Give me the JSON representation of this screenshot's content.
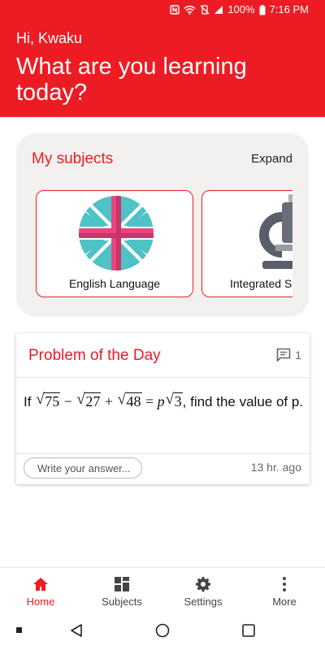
{
  "status_bar": {
    "battery": "100%",
    "time": "7:16 PM"
  },
  "header": {
    "greeting": "Hi, Kwaku",
    "headline": "What are you learning today?"
  },
  "subjects": {
    "title": "My subjects",
    "expand_label": "Expand",
    "items": [
      {
        "label": "English Language",
        "icon": "union-flag-icon"
      },
      {
        "label": "Integrated Science",
        "icon": "microscope-icon"
      }
    ]
  },
  "problem": {
    "title": "Problem of the Day",
    "comment_count": "1",
    "text_prefix": "If",
    "math": {
      "rad1": "75",
      "op1": "−",
      "rad2": "27",
      "op2": "+",
      "rad3": "48",
      "eq": "=",
      "var": "p",
      "rad4": "3"
    },
    "text_suffix": ", find the value of p.",
    "answer_placeholder": "Write your answer...",
    "timestamp": "13 hr. ago"
  },
  "nav": {
    "items": [
      {
        "label": "Home",
        "icon": "home-icon",
        "active": true
      },
      {
        "label": "Subjects",
        "icon": "grid-icon",
        "active": false
      },
      {
        "label": "Settings",
        "icon": "gear-icon",
        "active": false
      },
      {
        "label": "More",
        "icon": "more-vertical-icon",
        "active": false
      }
    ]
  },
  "colors": {
    "brand": "#ed1c24",
    "card_bg": "#f2f1ef"
  }
}
